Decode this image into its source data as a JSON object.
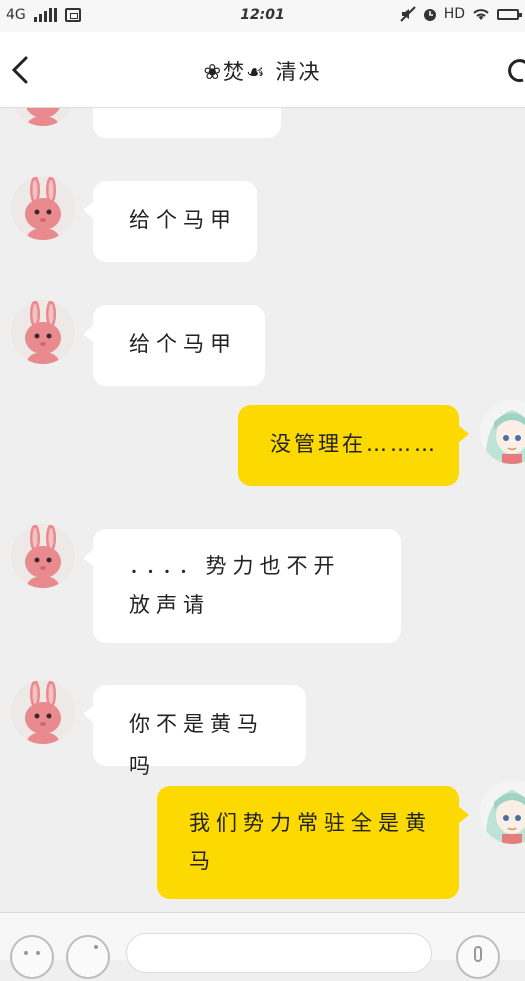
{
  "status_bar": {
    "network": "4G",
    "time": "12:01",
    "hd": "HD"
  },
  "header": {
    "title": "❀焚☙ 清决"
  },
  "messages": [
    {
      "side": "in",
      "text": ""
    },
    {
      "side": "in",
      "text": "给个马甲"
    },
    {
      "side": "in",
      "text": "给个马甲"
    },
    {
      "side": "out",
      "text": "没管理在………"
    },
    {
      "side": "in",
      "text": "．．．．势力也不开放声请"
    },
    {
      "side": "in",
      "text": "你不是黄马吗"
    },
    {
      "side": "out",
      "text": "我们势力常驻全是黄马"
    }
  ],
  "colors": {
    "background": "#efefef",
    "incoming_bubble": "#ffffff",
    "outgoing_bubble": "#fcd900"
  },
  "icons": {
    "back": "chevron-left-icon",
    "more": "more-icon",
    "avatar_in": "pink-bunny-avatar",
    "avatar_out": "anime-girl-avatar",
    "emoji": "smiley-icon",
    "voice": "microphone-icon"
  }
}
